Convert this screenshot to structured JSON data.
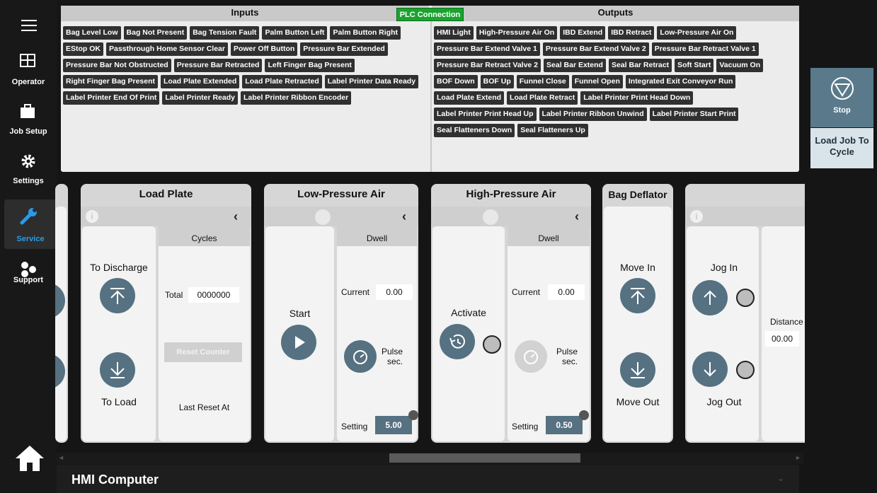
{
  "nav": {
    "items": [
      {
        "label": "Operator"
      },
      {
        "label": "Job Setup"
      },
      {
        "label": "Settings"
      },
      {
        "label": "Service"
      },
      {
        "label": "Support"
      }
    ]
  },
  "io": {
    "inputs_title": "Inputs",
    "outputs_title": "Outputs",
    "plc_label": "PLC Connection",
    "inputs": [
      "Bag Level Low",
      "Bag Not Present",
      "Bag Tension Fault",
      "Palm Button Left",
      "Palm Button Right",
      "EStop OK",
      "Passthrough Home Sensor Clear",
      "Power Off Button",
      "Pressure Bar Extended",
      "Pressure Bar Not Obstructed",
      "Pressure Bar Retracted",
      "Left Finger Bag Present",
      "Right Finger Bag Present",
      "Load Plate Extended",
      "Load Plate Retracted",
      "Label Printer Data Ready",
      "Label Printer End Of Print",
      "Label Printer Ready",
      "Label Printer Ribbon Encoder"
    ],
    "outputs": [
      "HMI Light",
      "High-Pressure Air On",
      "IBD Extend",
      "IBD Retract",
      "Low-Pressure Air On",
      "Pressure Bar Extend Valve 1",
      "Pressure Bar Extend Valve 2",
      "Pressure Bar Retract Valve 1",
      "Pressure Bar Retract Valve 2",
      "Seal Bar Extend",
      "Seal Bar Retract",
      "Soft Start",
      "Vacuum On",
      "BOF Down",
      "BOF Up",
      "Funnel Close",
      "Funnel Open",
      "Integrated Exit Conveyor Run",
      "Load Plate Extend",
      "Load Plate Retract",
      "Label Printer Print Head Down",
      "Label Printer Print Head Up",
      "Label Printer Ribbon Unwind",
      "Label Printer Start Print",
      "Seal Flatteners Down",
      "Seal Flatteners Up"
    ]
  },
  "cards": {
    "load_plate": {
      "title": "Load Plate",
      "cycles": "Cycles",
      "to_discharge": "To Discharge",
      "to_load": "To Load",
      "total_label": "Total",
      "total_value": "0000000",
      "reset_counter": "Reset Counter",
      "last_reset": "Last Reset At"
    },
    "low_air": {
      "title": "Low-Pressure Air",
      "dwell": "Dwell",
      "start": "Start",
      "current_label": "Current",
      "current_value": "0.00",
      "pulse": "Pulse\nsec.",
      "setting_label": "Setting",
      "setting_value": "5.00"
    },
    "high_air": {
      "title": "High-Pressure Air",
      "dwell": "Dwell",
      "activate": "Activate",
      "current_label": "Current",
      "current_value": "0.00",
      "pulse": "Pulse\nsec.",
      "setting_label": "Setting",
      "setting_value": "0.50"
    },
    "bag_deflator": {
      "title": "Bag Deflator",
      "move_in": "Move In",
      "move_out": "Move Out"
    },
    "jog": {
      "jog_in": "Jog In",
      "jog_out": "Jog Out",
      "distance_label": "Distance",
      "distance_value": "00.00"
    }
  },
  "right": {
    "stop_label": "Stop",
    "load_job_label": "Load Job To Cycle"
  },
  "bottom": {
    "title": "HMI Computer"
  }
}
